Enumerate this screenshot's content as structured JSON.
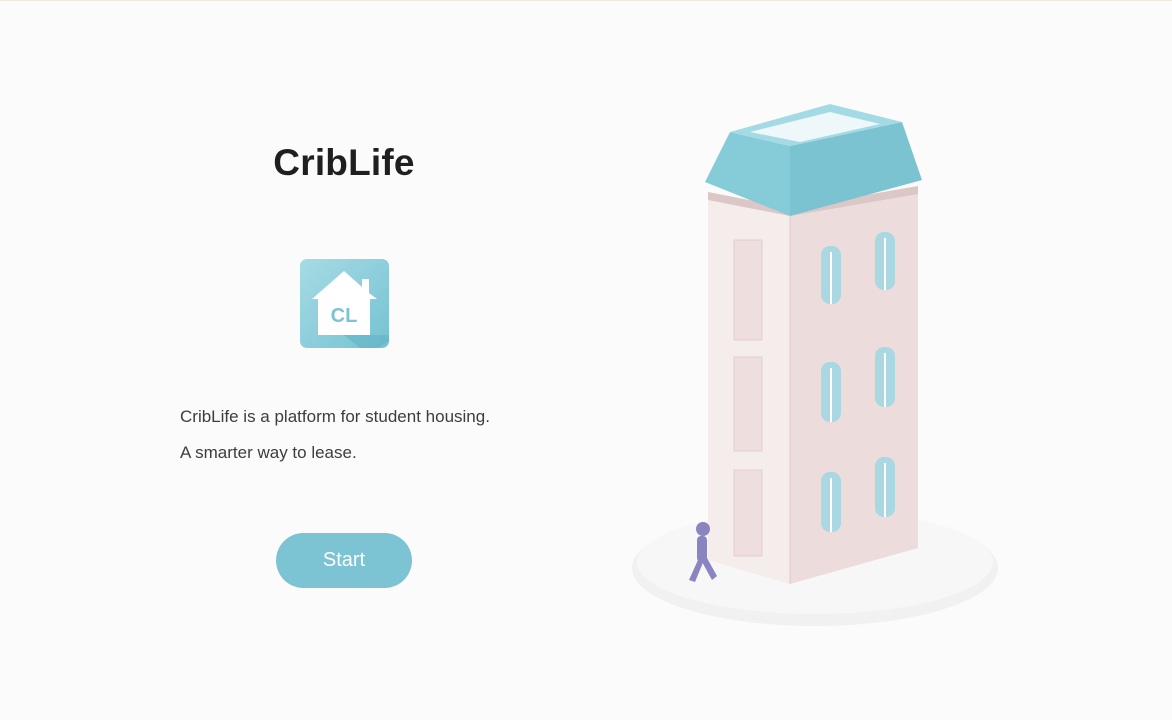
{
  "app": {
    "title": "CribLife",
    "logo_text": "CL"
  },
  "intro": {
    "line1": "CribLife is a platform for student housing.",
    "line2": "A smarter way to lease."
  },
  "actions": {
    "start_label": "Start"
  },
  "colors": {
    "accent": "#7cc4d3",
    "roof": "#8fd0dc",
    "building": "#f1e4e4",
    "person": "#8a84c0"
  }
}
